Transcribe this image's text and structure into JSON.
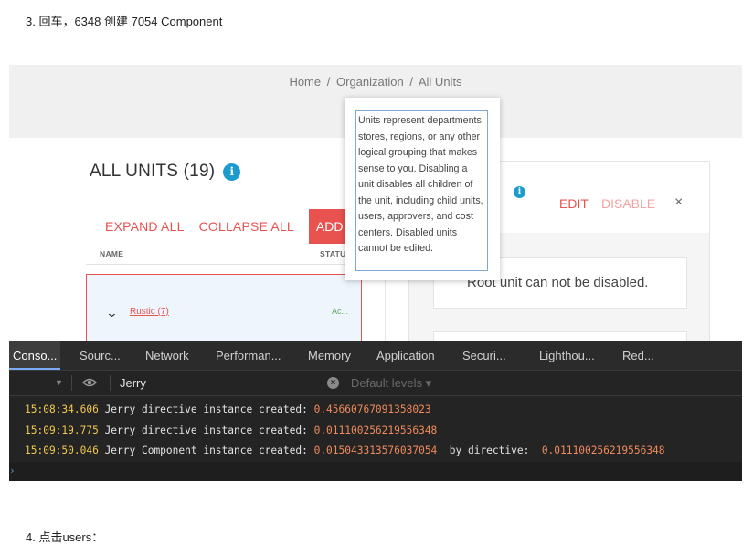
{
  "step3": "3. 回车，6348 创建 7054 Component",
  "step4": "4. 点击users：",
  "app": {
    "breadcrumb": [
      "Home",
      "/",
      "Organization",
      "/",
      "All Units"
    ],
    "page_title": "ALL UNITS (19)",
    "info_glyph": "i",
    "expand_all": "EXPAND ALL",
    "collapse_all": "COLLAPSE ALL",
    "add_label": "ADD",
    "columns": {
      "name": "NAME",
      "status": "STATUS"
    },
    "row": {
      "chevron": "⌄",
      "name": "Rustic (7)",
      "status": "Ac..."
    },
    "tooltip": "Units represent departments, stores, regions, or any other logical grouping that makes sense to you. Disabling a unit disables all children of the unit, including child units, users, approvers, and cost centers. Disabled units cannot be edited.",
    "detail": {
      "edit": "EDIT",
      "disable": "DISABLE",
      "close": "×",
      "message": "Root unit can not be disabled."
    }
  },
  "devtools": {
    "tabs": [
      "Conso...",
      "Sourc...",
      "Network",
      "Performan...",
      "Memory",
      "Application",
      "Securi...",
      "Lighthou...",
      "Red..."
    ],
    "filter_value": "Jerry",
    "clear": "×",
    "levels": "Default levels ▾",
    "toolbar_arrow": "▼",
    "prompt": "›",
    "logs": [
      {
        "time": "15:08:34.606",
        "text": " Jerry directive instance created: ",
        "value": "0.45660767091358023",
        "extra": "",
        "extra_value": ""
      },
      {
        "time": "15:09:19.775",
        "text": " Jerry directive instance created: ",
        "value": "0.011100256219556348",
        "extra": "",
        "extra_value": ""
      },
      {
        "time": "15:09:50.046",
        "text": " Jerry Component instance created: ",
        "value": "0.015043313576037054",
        "extra": "  by directive:  ",
        "extra_value": "0.011100256219556348"
      }
    ]
  },
  "colors": {
    "accent_red": "#e8524f",
    "info_blue": "#1b9ccc",
    "timestamp": "#f2c94c",
    "number": "#f08a5a"
  }
}
